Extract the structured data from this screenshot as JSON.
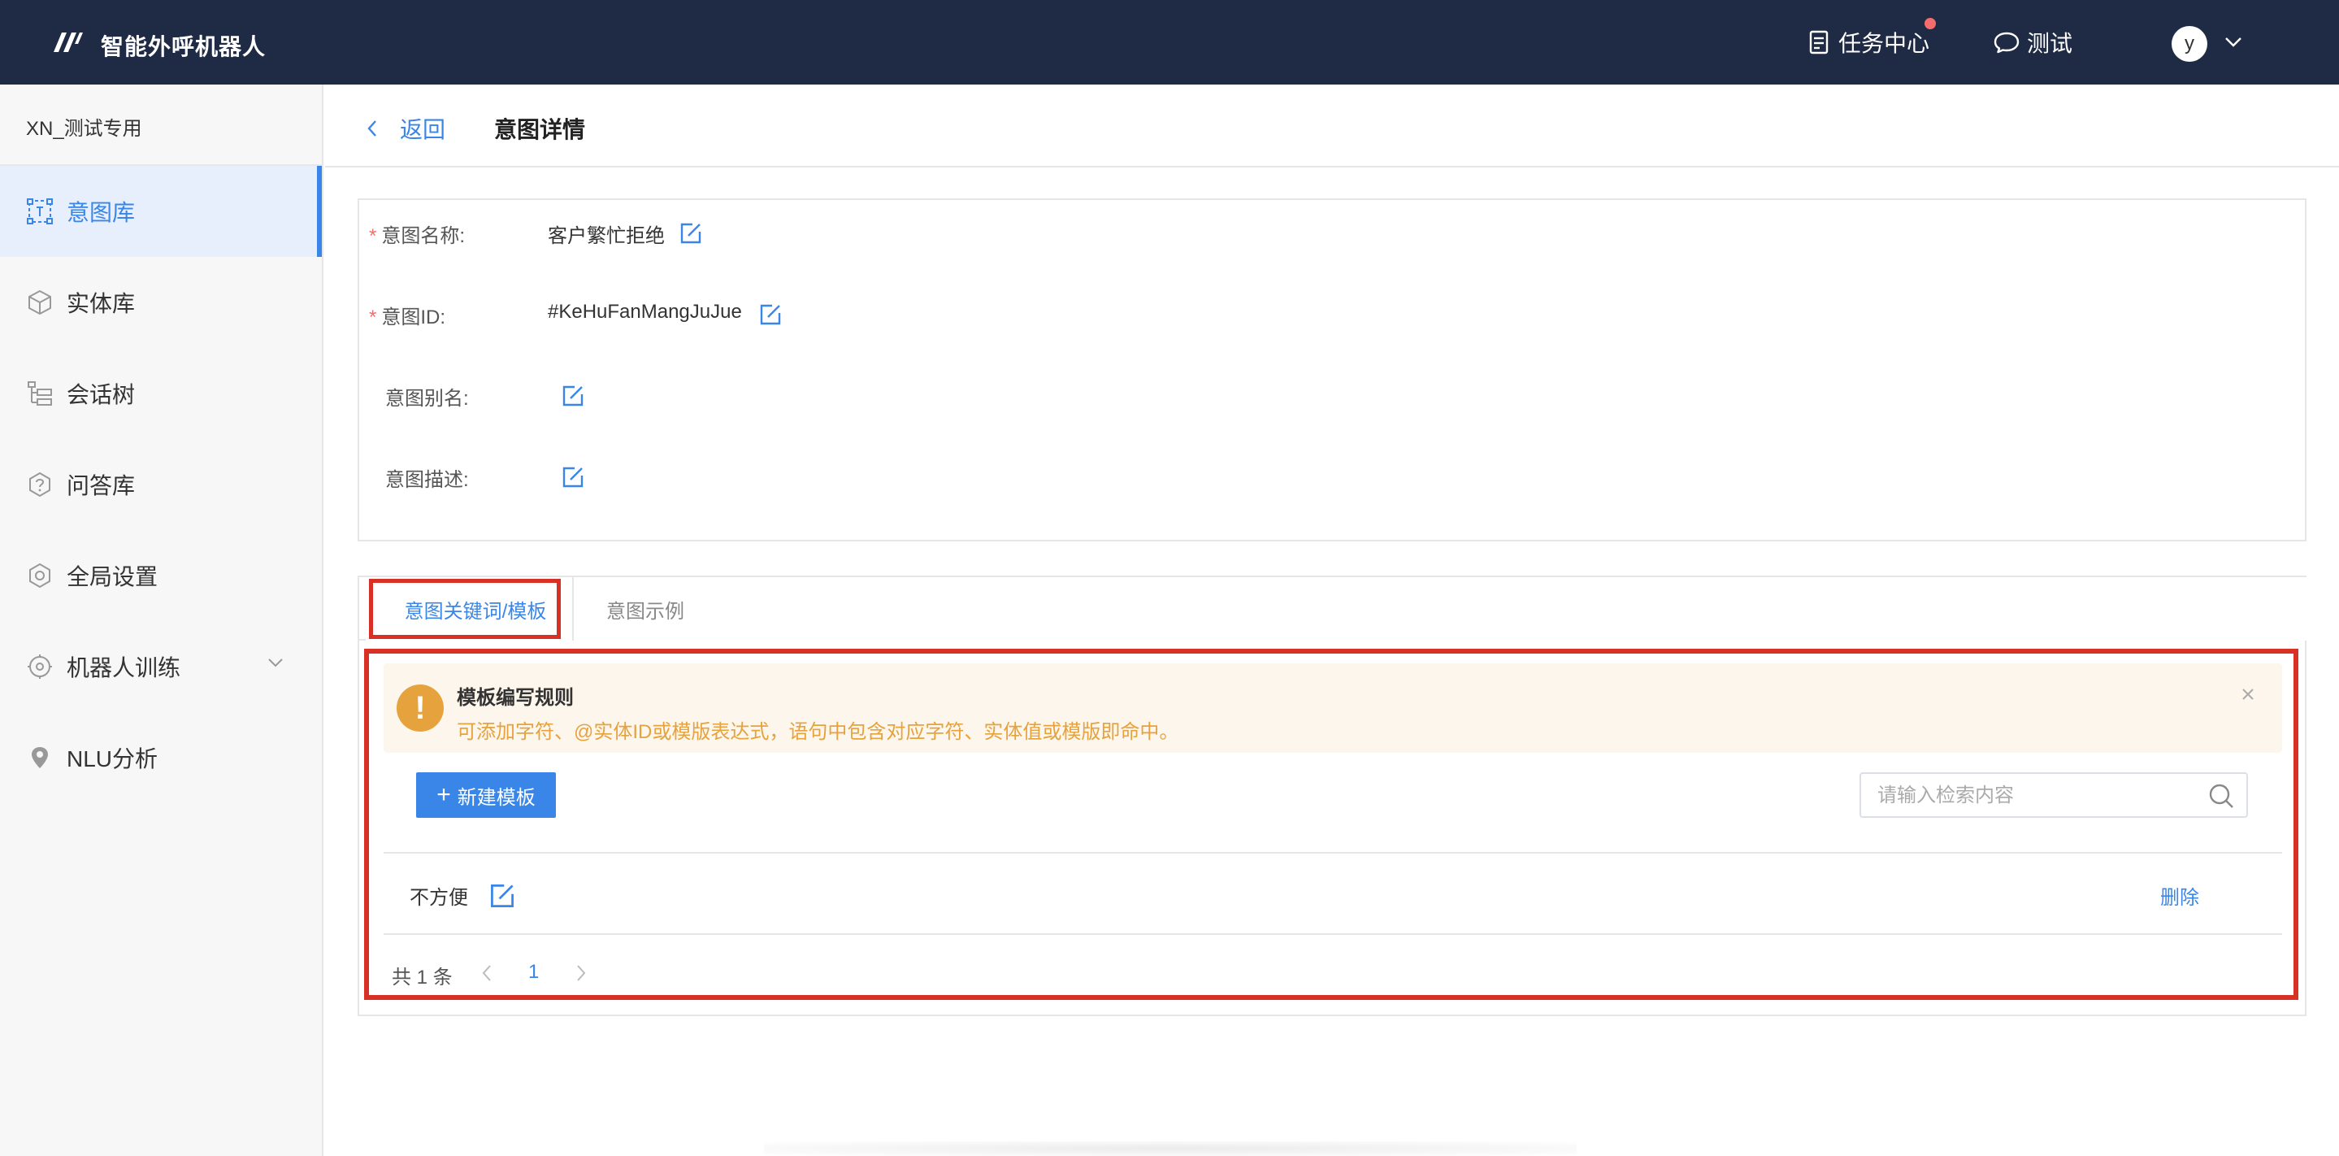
{
  "app": {
    "title": "智能外呼机器人",
    "logo_icon": "logo-icon"
  },
  "topnav": {
    "task_center": "任务中心",
    "test": "测试",
    "avatar_letter": "y"
  },
  "sidebar": {
    "project_name": "XN_测试专用",
    "items": [
      {
        "label": "意图库",
        "icon": "intent-icon",
        "active": true
      },
      {
        "label": "实体库",
        "icon": "cube-icon"
      },
      {
        "label": "会话树",
        "icon": "tree-icon"
      },
      {
        "label": "问答库",
        "icon": "question-icon"
      },
      {
        "label": "全局设置",
        "icon": "settings-icon"
      },
      {
        "label": "机器人训练",
        "icon": "robot-icon",
        "has_children": true
      },
      {
        "label": "NLU分析",
        "icon": "nlu-icon"
      }
    ]
  },
  "header": {
    "back_label": "返回",
    "page_title": "意图详情"
  },
  "intent": {
    "name_label": "意图名称:",
    "name_value": "客户繁忙拒绝",
    "id_label": "意图ID:",
    "id_value": "#KeHuFanMangJuJue",
    "alias_label": "意图别名:",
    "desc_label": "意图描述:"
  },
  "tabs": [
    {
      "label": "意图关键词/模板",
      "active": true
    },
    {
      "label": "意图示例"
    }
  ],
  "alert": {
    "title": "模板编写规则",
    "description": "可添加字符、@实体ID或模版表达式，语句中包含对应字符、实体值或模版即命中。"
  },
  "toolbar": {
    "new_label": "新建模板",
    "search_placeholder": "请输入检索内容"
  },
  "templates": [
    {
      "text": "不方便",
      "delete_label": "删除"
    }
  ],
  "pagination": {
    "total_label": "共 1 条",
    "current_page": "1"
  },
  "colors": {
    "topbar": "#1f2a44",
    "primary": "#3a86e8",
    "warning": "#e6a23c",
    "highlight": "#d93025"
  }
}
